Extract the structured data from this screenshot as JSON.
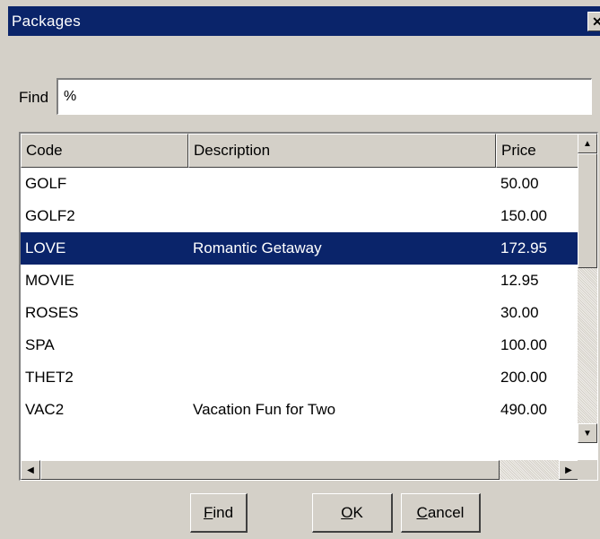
{
  "window": {
    "title": "Packages",
    "close_glyph": "✕"
  },
  "search": {
    "label": "Find",
    "value": "%"
  },
  "table": {
    "columns": [
      "Code",
      "Description",
      "Price"
    ],
    "rows": [
      {
        "code": "GOLF",
        "description": "",
        "price": "50.00",
        "selected": false
      },
      {
        "code": "GOLF2",
        "description": "",
        "price": "150.00",
        "selected": false
      },
      {
        "code": "LOVE",
        "description": "Romantic Getaway",
        "price": "172.95",
        "selected": true
      },
      {
        "code": "MOVIE",
        "description": "",
        "price": "12.95",
        "selected": false
      },
      {
        "code": "ROSES",
        "description": "",
        "price": "30.00",
        "selected": false
      },
      {
        "code": "SPA",
        "description": "",
        "price": "100.00",
        "selected": false
      },
      {
        "code": "THET2",
        "description": "",
        "price": "200.00",
        "selected": false
      },
      {
        "code": "VAC2",
        "description": "Vacation Fun for Two",
        "price": "490.00",
        "selected": false
      }
    ]
  },
  "buttons": {
    "find": {
      "mnemonic": "F",
      "rest": "ind"
    },
    "ok": {
      "mnemonic": "O",
      "rest": "K"
    },
    "cancel": {
      "mnemonic": "C",
      "rest": "ancel"
    }
  },
  "icons": {
    "scroll_up": "▲",
    "scroll_down": "▼",
    "scroll_left": "◀",
    "scroll_right": "▶"
  },
  "colors": {
    "titlebar": "#0a246a",
    "selection": "#0a246a",
    "dialog_bg": "#d4d0c8"
  }
}
